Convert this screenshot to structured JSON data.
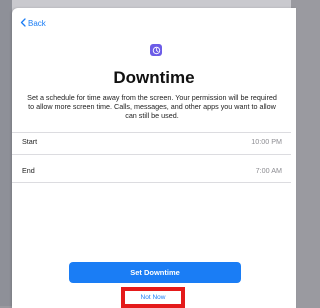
{
  "nav": {
    "back_label": "Back"
  },
  "header": {
    "icon": "hourglass-icon",
    "title": "Downtime"
  },
  "description": "Set a schedule for time away from the screen. Your permission will be required to allow more screen time. Calls, messages, and other apps you want to allow can still be used.",
  "schedule": {
    "rows": [
      {
        "label": "Start",
        "value": "10:00 PM"
      },
      {
        "label": "End",
        "value": "7:00 AM"
      }
    ]
  },
  "actions": {
    "primary_label": "Set Downtime",
    "secondary_label": "Not Now"
  },
  "colors": {
    "accent": "#1a7df5",
    "icon_bg": "#6c5ce7",
    "highlight": "#e41a1a"
  }
}
